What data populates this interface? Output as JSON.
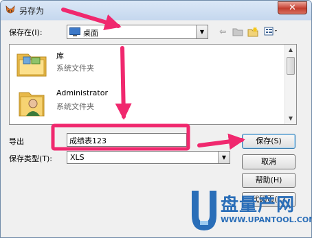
{
  "window": {
    "title": "另存为",
    "close_label": "✕"
  },
  "save_in": {
    "label": "保存在(I):",
    "value": "桌面"
  },
  "file_list": [
    {
      "name": "库",
      "type": "系统文件夹"
    },
    {
      "name": "Administrator",
      "type": "系统文件夹"
    }
  ],
  "export": {
    "label": "导出",
    "value": "成绩表123"
  },
  "save_type": {
    "label": "保存类型(T):",
    "value": "XLS"
  },
  "buttons": {
    "save": "保存(S)",
    "cancel": "取消",
    "help": "帮助(H)",
    "codepage": "代码页(C)"
  },
  "watermark": {
    "brand": "盘量产网",
    "url": "WWW.UPANTOOL.COM"
  },
  "colors": {
    "annotation": "#f0286e",
    "brand": "#2a6eb8"
  }
}
